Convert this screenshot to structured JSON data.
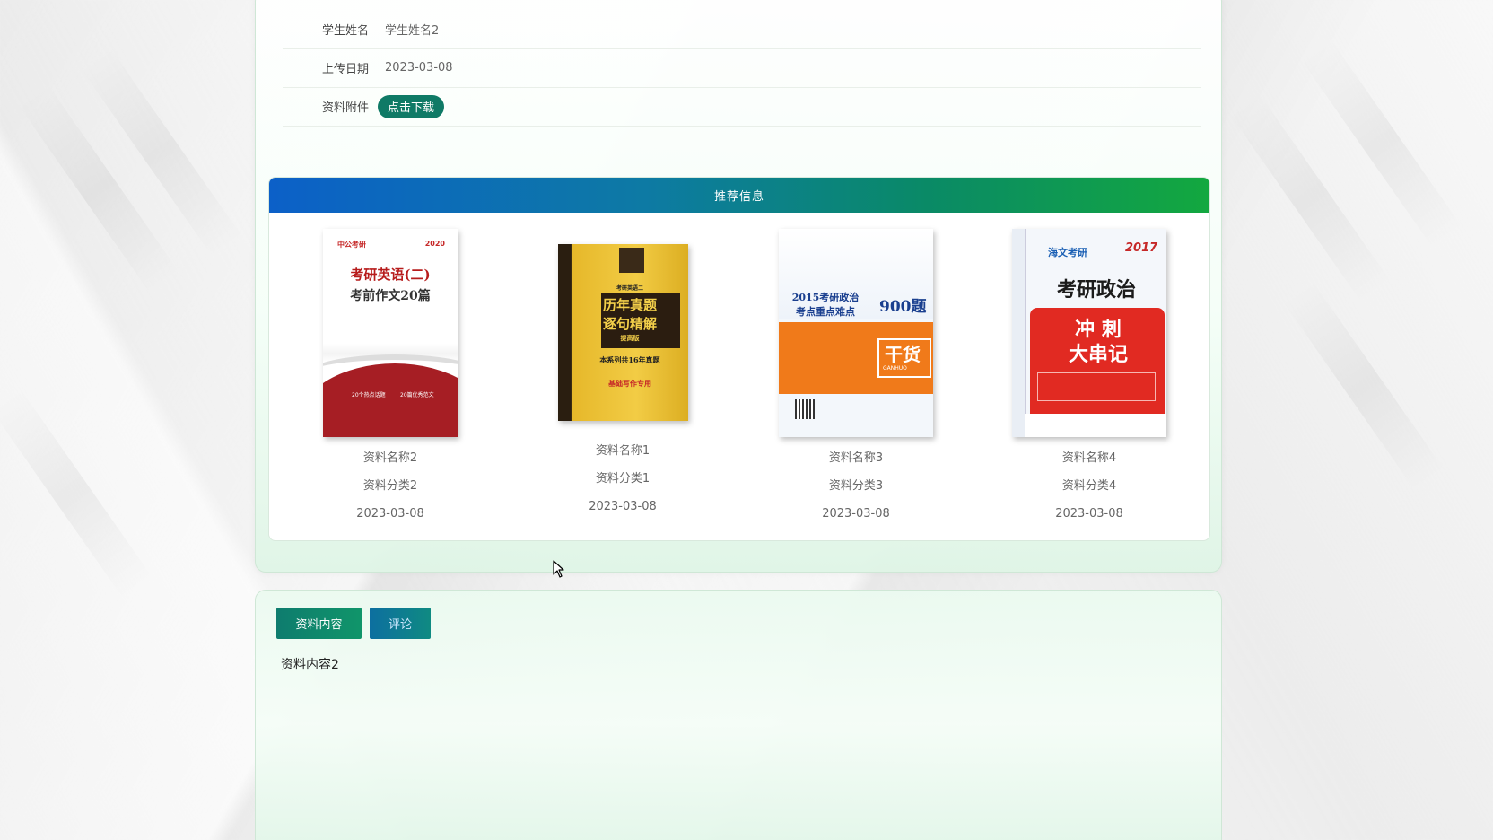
{
  "detail": {
    "rows": [
      {
        "label": "学生姓名",
        "value": "学生姓名2"
      },
      {
        "label": "上传日期",
        "value": "2023-03-08"
      },
      {
        "label": "资料附件",
        "button": "点击下载"
      }
    ]
  },
  "recommend": {
    "title": "推荐信息",
    "items": [
      {
        "name": "资料名称2",
        "category": "资料分类2",
        "date": "2023-03-08",
        "cover": {
          "brand": "中公考研",
          "year": "2020",
          "title_line1": "考研英语(二)",
          "title_line2": "考前作文20篇",
          "bottom_left": "20个热点话题",
          "bottom_right": "20篇优秀范文"
        }
      },
      {
        "name": "资料名称1",
        "category": "资料分类1",
        "date": "2023-03-08",
        "cover": {
          "subtitle": "考研英语二",
          "title_line1": "历年真题",
          "title_line2": "逐句精解",
          "tag": "提高版",
          "note": "本系列共16年真题",
          "bottom": "基础写作专用"
        }
      },
      {
        "name": "资料名称3",
        "category": "资料分类3",
        "date": "2023-03-08",
        "cover": {
          "title_line1": "2015考研政治",
          "title_line2": "考点重点难点",
          "count": "900题",
          "badge": "干货",
          "badge_sub": "GANHUO"
        }
      },
      {
        "name": "资料名称4",
        "category": "资料分类4",
        "date": "2023-03-08",
        "cover": {
          "brand": "海文考研",
          "year": "2017",
          "title": "考研政治",
          "big_line1": "冲 刺",
          "big_line2": "大串记"
        }
      }
    ]
  },
  "content": {
    "tabs": [
      "资料内容",
      "评论"
    ],
    "text": "资料内容2"
  },
  "colors": {
    "accent_green": "#0f7a66",
    "header_gradient_start": "#0c60c8",
    "header_gradient_end": "#13a83f"
  }
}
